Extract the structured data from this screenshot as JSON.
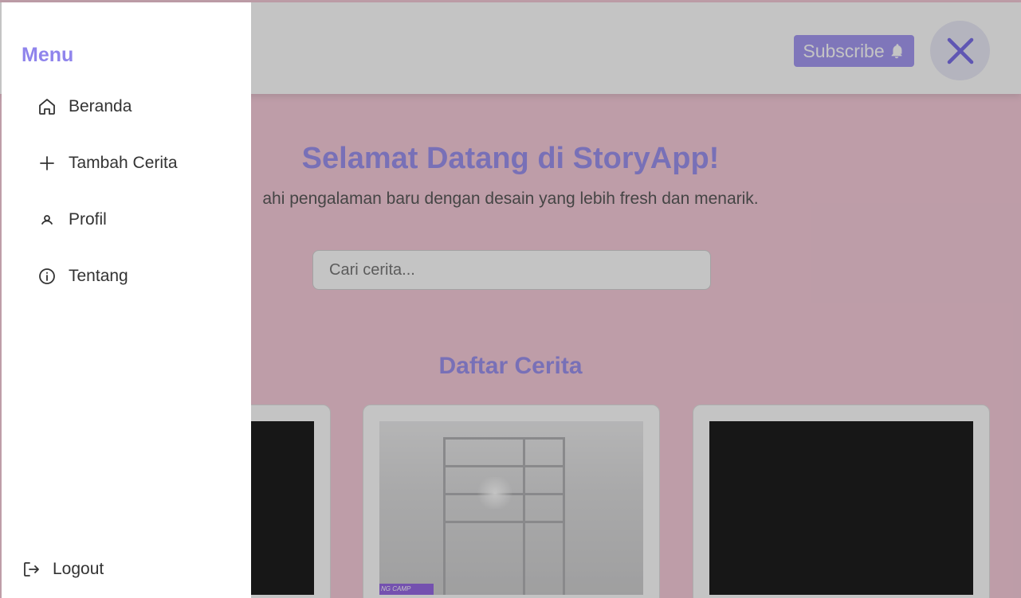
{
  "header": {
    "subscribe_label": "Subscribe",
    "bell_icon": "bell-icon",
    "close_icon": "close-icon"
  },
  "hero": {
    "title": "Selamat Datang di StoryApp!",
    "subtitle": "ahi pengalaman baru dengan desain yang lebih fresh dan menarik."
  },
  "search": {
    "placeholder": "Cari cerita..."
  },
  "section": {
    "title": "Daftar Cerita"
  },
  "cards": [
    {
      "image_text": ""
    },
    {
      "image_text": "NG CAMP"
    },
    {
      "image_text": ""
    }
  ],
  "drawer": {
    "title": "Menu",
    "items": [
      {
        "label": "Beranda",
        "icon": "home-icon"
      },
      {
        "label": "Tambah Cerita",
        "icon": "plus-icon"
      },
      {
        "label": "Profil",
        "icon": "user-icon"
      },
      {
        "label": "Tentang",
        "icon": "info-icon"
      }
    ],
    "logout_label": "Logout"
  },
  "colors": {
    "accent": "#8f84ec",
    "page_bg": "#f6c6d6",
    "subscribe_bg": "#9a8cf0"
  }
}
